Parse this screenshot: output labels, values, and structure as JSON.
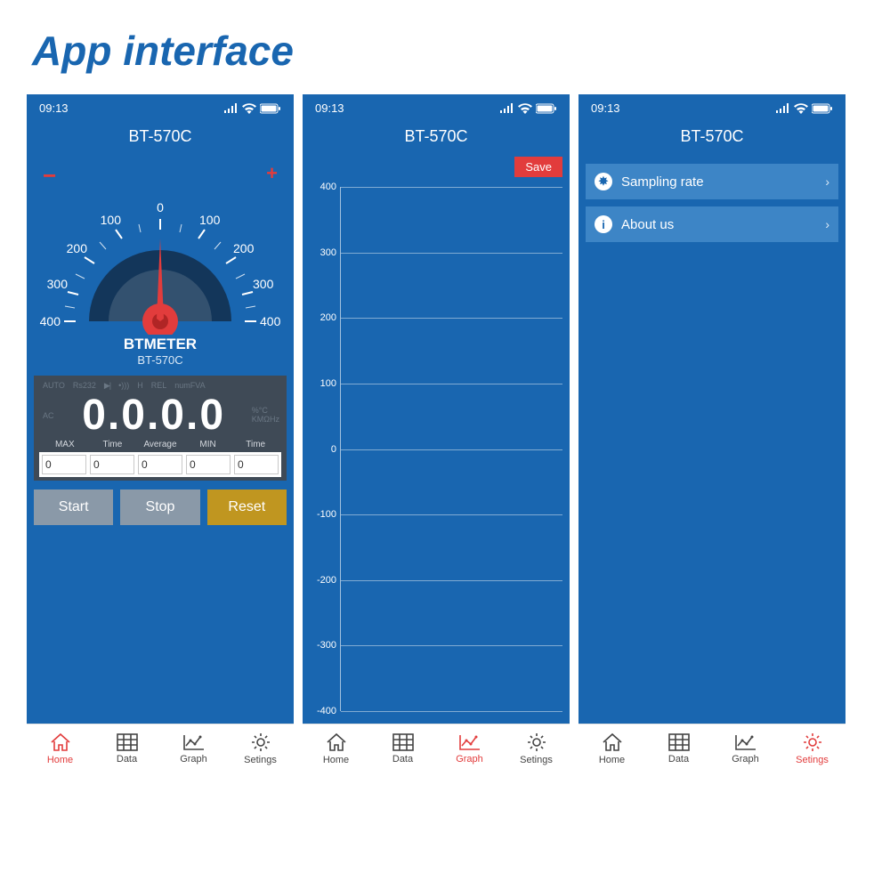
{
  "page": {
    "heading": "App interface"
  },
  "status": {
    "time": "09:13"
  },
  "device": {
    "title": "BT-570C",
    "brand": "BTMETER",
    "model": "BT-570C"
  },
  "gauge": {
    "center_label": "0",
    "minus": "−",
    "plus": "+",
    "tick_labels_left": [
      "100",
      "200",
      "300",
      "400"
    ],
    "tick_labels_right": [
      "100",
      "200",
      "300",
      "400"
    ]
  },
  "display": {
    "top_labels": [
      "AUTO",
      "Rs232",
      "▶|",
      "•)))",
      "H",
      "REL",
      "numFVA"
    ],
    "left_label": "AC",
    "reading": "0.0.0.0",
    "right_top": "%°C",
    "right_bottom": "KMΩHz",
    "stats_labels": [
      "MAX",
      "Time",
      "Average",
      "MIN",
      "Time"
    ],
    "stats_values": [
      "0",
      "0",
      "0",
      "0",
      "0"
    ]
  },
  "buttons": {
    "start": "Start",
    "stop": "Stop",
    "reset": "Reset"
  },
  "graph": {
    "save": "Save",
    "y_ticks": [
      "400",
      "300",
      "200",
      "100",
      "0",
      "-100",
      "-200",
      "-300",
      "-400"
    ]
  },
  "settings": {
    "items": [
      {
        "label": "Sampling rate",
        "icon": "✸"
      },
      {
        "label": "About us",
        "icon": "i"
      }
    ]
  },
  "tabs": {
    "home": "Home",
    "data": "Data",
    "graph": "Graph",
    "settings": "Setings"
  },
  "chart_data": {
    "type": "line",
    "x": [],
    "series": [],
    "ylim": [
      -400,
      400
    ],
    "y_ticks": [
      400,
      300,
      200,
      100,
      0,
      -100,
      -200,
      -300,
      -400
    ],
    "xlabel": "",
    "ylabel": "",
    "title": ""
  }
}
